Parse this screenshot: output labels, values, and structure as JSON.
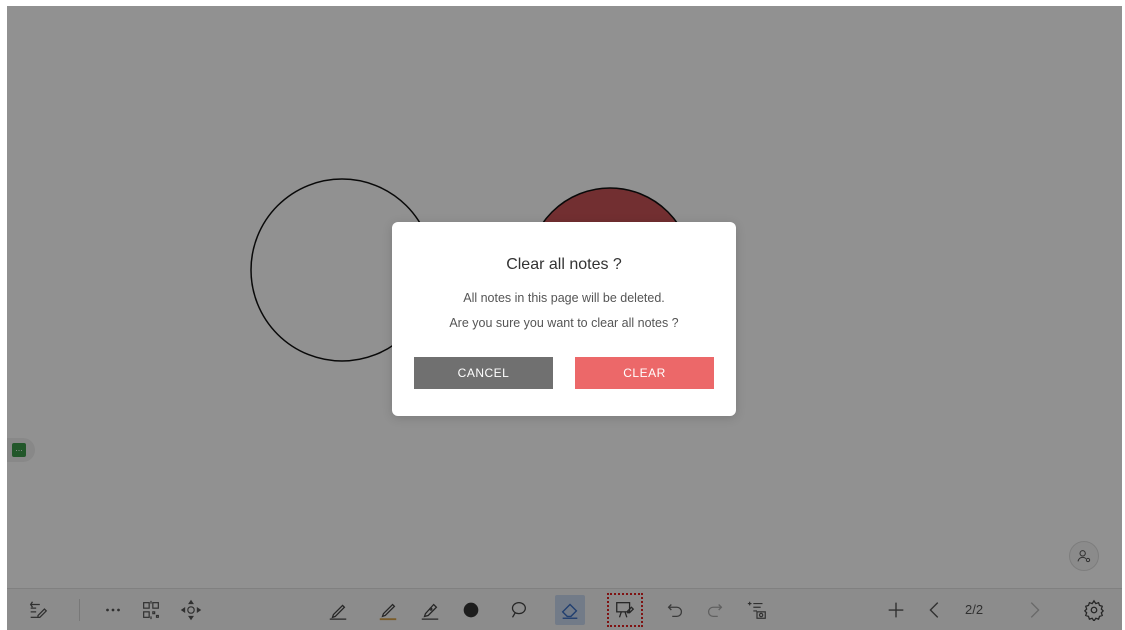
{
  "dialog": {
    "title": "Clear all notes ?",
    "message_line1": "All notes in this page will be deleted.",
    "message_line2": "Are you sure you want to clear all notes ?",
    "cancel_label": "CANCEL",
    "clear_label": "CLEAR"
  },
  "side_tab": {
    "label": "..."
  },
  "toolbar": {
    "page_indicator": "2/2",
    "left_tools": [
      "notes-list-icon",
      "more-icon",
      "qr-code-icon",
      "move-icon"
    ],
    "center_tools": [
      "pen-icon",
      "highlighter-icon",
      "brush-pen-icon",
      "fill-dot-icon",
      "lasso-icon",
      "eraser-icon",
      "clear-screen-icon",
      "undo-icon",
      "redo-icon",
      "screenshot-icon"
    ],
    "right_tools": [
      "add-page-icon",
      "prev-page-icon",
      "next-page-icon",
      "settings-icon"
    ]
  },
  "colors": {
    "overlay": "#8f8f8f",
    "clear_button": "#ec6869",
    "cancel_button": "#707070",
    "red_circle": "#c85457",
    "eraser_active_bg": "#c9d8f0",
    "side_tab_green": "#3d9a4b"
  }
}
